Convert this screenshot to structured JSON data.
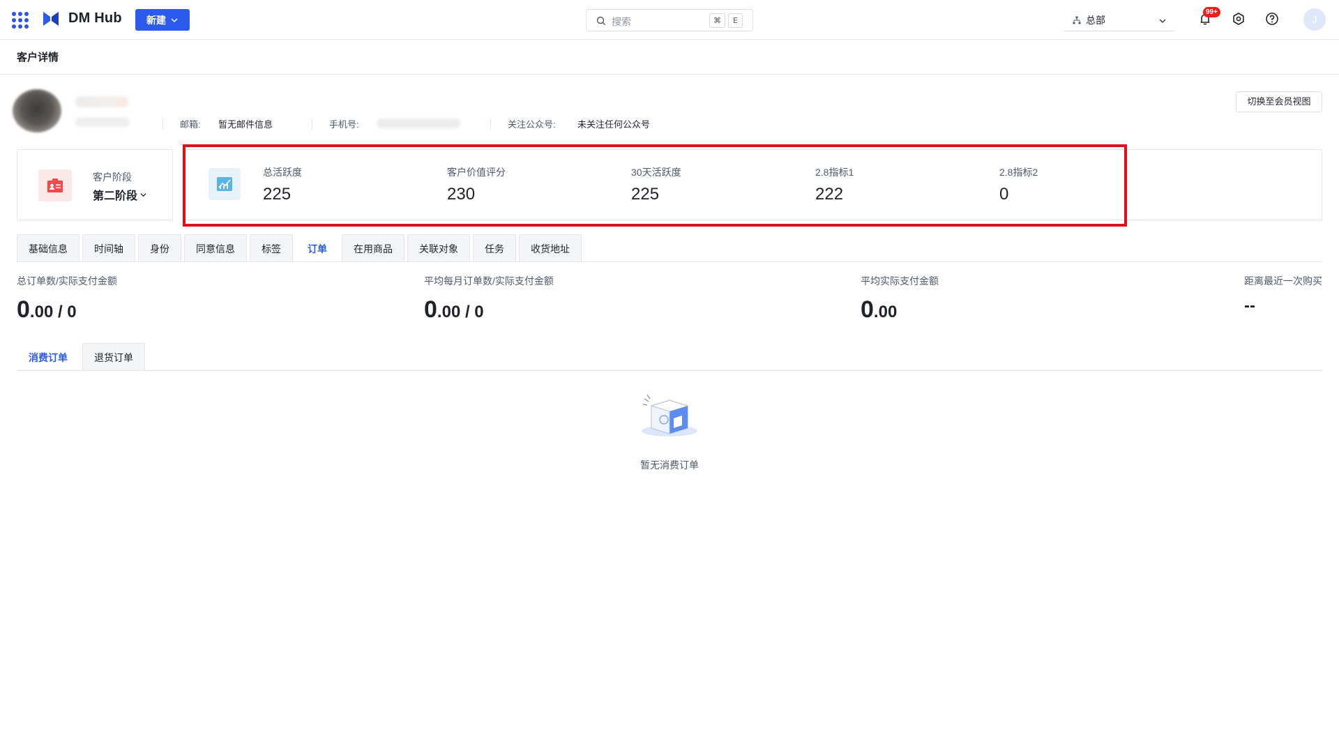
{
  "app": {
    "name": "DM Hub",
    "new_button": "新建"
  },
  "search": {
    "placeholder": "搜索",
    "shortcut_keys": [
      "⌘",
      "E"
    ]
  },
  "org_selector": {
    "label": "总部"
  },
  "notifications": {
    "badge": "99+"
  },
  "user": {
    "avatar_initial": "J"
  },
  "page": {
    "title": "客户详情"
  },
  "profile": {
    "email_label": "邮箱:",
    "email_value": "暂无邮件信息",
    "phone_label": "手机号:",
    "wechat_label": "关注公众号:",
    "wechat_value": "未关注任何公众号",
    "switch_view_button": "切换至会员视图"
  },
  "stage": {
    "label": "客户阶段",
    "value": "第二阶段"
  },
  "metrics": [
    {
      "label": "总活跃度",
      "value": "225"
    },
    {
      "label": "客户价值评分",
      "value": "230"
    },
    {
      "label": "30天活跃度",
      "value": "225"
    },
    {
      "label": "2.8指标1",
      "value": "222"
    },
    {
      "label": "2.8指标2",
      "value": "0"
    }
  ],
  "tabs": [
    {
      "label": "基础信息",
      "active": false
    },
    {
      "label": "时间轴",
      "active": false
    },
    {
      "label": "身份",
      "active": false
    },
    {
      "label": "同意信息",
      "active": false
    },
    {
      "label": "标签",
      "active": false
    },
    {
      "label": "订单",
      "active": true
    },
    {
      "label": "在用商品",
      "active": false
    },
    {
      "label": "关联对象",
      "active": false
    },
    {
      "label": "任务",
      "active": false
    },
    {
      "label": "收货地址",
      "active": false
    }
  ],
  "order_stats": [
    {
      "label": "总订单数/实际支付金额",
      "int": "0",
      "rest": ".00 / 0"
    },
    {
      "label": "平均每月订单数/实际支付金额",
      "int": "0",
      "rest": ".00 / 0"
    },
    {
      "label": "平均实际支付金额",
      "int": "0",
      "rest": ".00"
    },
    {
      "label": "距离最近一次购买",
      "int": "--",
      "rest": ""
    }
  ],
  "sub_tabs": [
    {
      "label": "消费订单",
      "active": true
    },
    {
      "label": "退货订单",
      "active": false
    }
  ],
  "empty_state": {
    "text": "暂无消费订单"
  },
  "colors": {
    "primary": "#2b5aed",
    "highlight": "#e0101a",
    "badge": "#e8201a"
  }
}
